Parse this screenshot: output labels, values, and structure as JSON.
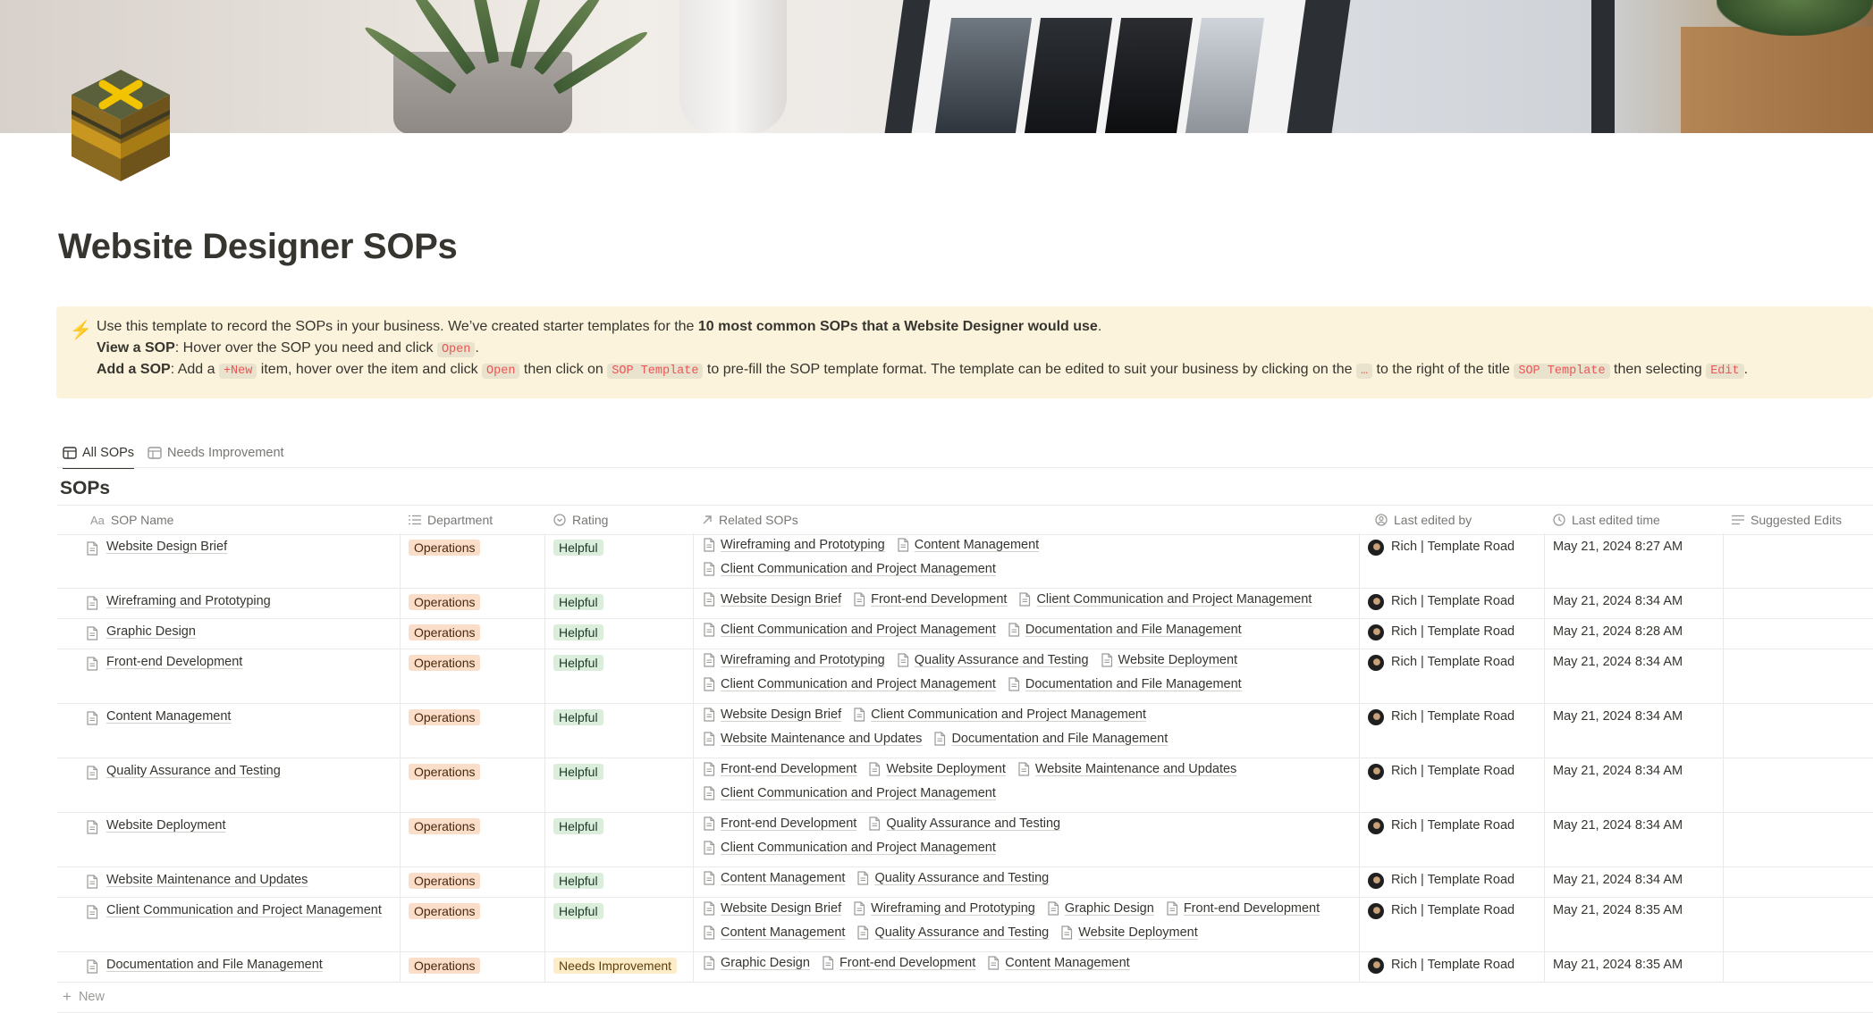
{
  "page": {
    "title": "Website Designer SOPs"
  },
  "callout": {
    "icon": "lightning-icon",
    "line1_text": "Use this template to record the SOPs in your business. We’ve created starter templates for the ",
    "line1_bold": "10 most common SOPs that a Website Designer would use",
    "line1_end": ".",
    "line2_bold": "View a SOP",
    "line2_text": ": Hover over the SOP you need and click ",
    "line2_code": "Open",
    "line2_end": ".",
    "line3_bold": "Add a SOP",
    "line3_text1": ": Add a ",
    "line3_code1": "+New",
    "line3_text2": " item, hover over the item and click ",
    "line3_code2": "Open",
    "line3_text3": " then click on ",
    "line3_code3": "SOP Template",
    "line3_text4": " to pre-fill the SOP template format. The template can be edited to suit your business by clicking on the ",
    "line3_code4": "…",
    "line3_text5": " to the right of the title ",
    "line3_code5": "SOP Template",
    "line3_text6": " then selecting ",
    "line3_code6": "Edit",
    "line3_end": "."
  },
  "tabs": [
    {
      "label": "All SOPs",
      "active": true
    },
    {
      "label": "Needs Improvement",
      "active": false
    }
  ],
  "database": {
    "title": "SOPs",
    "columns": [
      "SOP Name",
      "Department",
      "Rating",
      "Related SOPs",
      "Last edited by",
      "Last edited time",
      "Suggested Edits"
    ],
    "new_label": "New",
    "rows": [
      {
        "name": "Website Design Brief",
        "department": "Operations",
        "rating": "Helpful",
        "related": [
          [
            "Wireframing and Prototyping",
            "Content Management"
          ],
          [
            "Client Communication and Project Management"
          ]
        ],
        "edited_by": "Rich | Template Road",
        "edited_time": "May 21, 2024 8:27 AM"
      },
      {
        "name": "Wireframing and Prototyping",
        "department": "Operations",
        "rating": "Helpful",
        "related": [
          [
            "Website Design Brief",
            "Front-end Development",
            "Client Communication and Project Management"
          ]
        ],
        "edited_by": "Rich | Template Road",
        "edited_time": "May 21, 2024 8:34 AM"
      },
      {
        "name": "Graphic Design",
        "department": "Operations",
        "rating": "Helpful",
        "related": [
          [
            "Client Communication and Project Management",
            "Documentation and File Management"
          ]
        ],
        "edited_by": "Rich | Template Road",
        "edited_time": "May 21, 2024 8:28 AM"
      },
      {
        "name": "Front-end Development",
        "department": "Operations",
        "rating": "Helpful",
        "related": [
          [
            "Wireframing and Prototyping",
            "Quality Assurance and Testing",
            "Website Deployment"
          ],
          [
            "Client Communication and Project Management",
            "Documentation and File Management"
          ]
        ],
        "edited_by": "Rich | Template Road",
        "edited_time": "May 21, 2024 8:34 AM"
      },
      {
        "name": "Content Management",
        "department": "Operations",
        "rating": "Helpful",
        "related": [
          [
            "Website Design Brief",
            "Client Communication and Project Management"
          ],
          [
            "Website Maintenance and Updates",
            "Documentation and File Management"
          ]
        ],
        "edited_by": "Rich | Template Road",
        "edited_time": "May 21, 2024 8:34 AM"
      },
      {
        "name": "Quality Assurance and Testing",
        "department": "Operations",
        "rating": "Helpful",
        "related": [
          [
            "Front-end Development",
            "Website Deployment",
            "Website Maintenance and Updates"
          ],
          [
            "Client Communication and Project Management"
          ]
        ],
        "edited_by": "Rich | Template Road",
        "edited_time": "May 21, 2024 8:34 AM"
      },
      {
        "name": "Website Deployment",
        "department": "Operations",
        "rating": "Helpful",
        "related": [
          [
            "Front-end Development",
            "Quality Assurance and Testing"
          ],
          [
            "Client Communication and Project Management"
          ]
        ],
        "edited_by": "Rich | Template Road",
        "edited_time": "May 21, 2024 8:34 AM"
      },
      {
        "name": "Website Maintenance and Updates",
        "department": "Operations",
        "rating": "Helpful",
        "related": [
          [
            "Content Management",
            "Quality Assurance and Testing"
          ]
        ],
        "edited_by": "Rich | Template Road",
        "edited_time": "May 21, 2024 8:34 AM"
      },
      {
        "name": "Client Communication and Project Management",
        "department": "Operations",
        "rating": "Helpful",
        "related": [
          [
            "Website Design Brief",
            "Wireframing and Prototyping",
            "Graphic Design",
            "Front-end Development"
          ],
          [
            "Content Management",
            "Quality Assurance and Testing",
            "Website Deployment"
          ]
        ],
        "edited_by": "Rich | Template Road",
        "edited_time": "May 21, 2024 8:35 AM"
      },
      {
        "name": "Documentation and File Management",
        "department": "Operations",
        "rating": "Needs Improvement",
        "related": [
          [
            "Graphic Design",
            "Front-end Development",
            "Content Management"
          ]
        ],
        "edited_by": "Rich | Template Road",
        "edited_time": "May 21, 2024 8:35 AM"
      }
    ]
  }
}
